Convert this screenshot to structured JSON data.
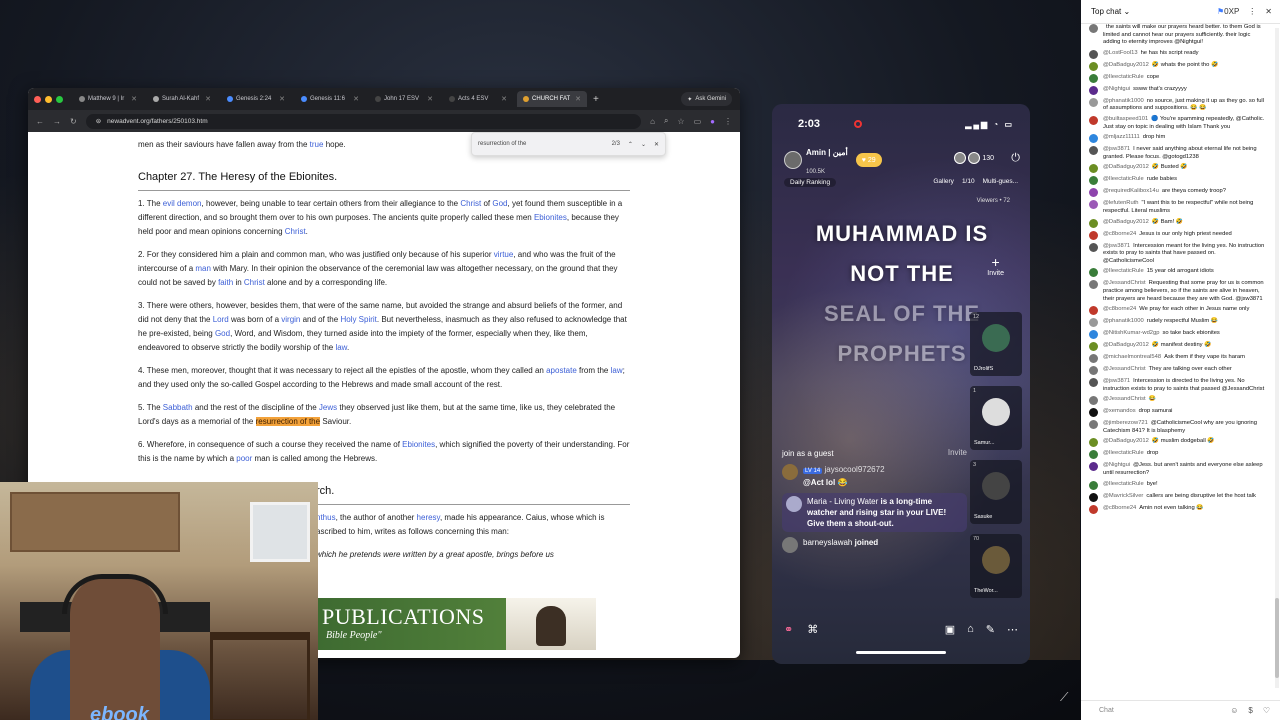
{
  "browser": {
    "tabs": [
      {
        "label": "Matthew 9 | Ir"
      },
      {
        "label": "Surah Al-Kahf"
      },
      {
        "label": "Genesis 2:24"
      },
      {
        "label": "Genesis 11:6"
      },
      {
        "label": "John 17 ESV"
      },
      {
        "label": "Acts 4 ESV"
      },
      {
        "label": "CHURCH FAT"
      }
    ],
    "new_tab": "+",
    "ask_gemini": "Ask Gemini",
    "url": "newadvent.org/fathers/250103.htm",
    "find": {
      "query": "resurrection of the",
      "count": "2/3"
    }
  },
  "page": {
    "top_line_pre": "men as their saviours have fallen away from the",
    "top_line_link": "true",
    "top_line_post": "hope.",
    "chapter_title": "Chapter 27. The Heresy of the Ebionites.",
    "p1": {
      "a": "1. The",
      "l1": "evil",
      "l2": "demon",
      "b": ", however, being unable to tear certain others from their allegiance to the",
      "l3": "Christ",
      "c": "of",
      "l4": "God",
      "d": ", yet found them susceptible in a different direction, and so brought them over to his own purposes. The ancients quite properly called these men",
      "l5": "Ebionites",
      "e": ", because they held poor and mean opinions concerning",
      "l6": "Christ",
      "f": "."
    },
    "p2": {
      "a": "2. For they considered him a plain and common man, who was justified only because of his superior",
      "l1": "virtue",
      "b": ", and who was the fruit of the intercourse of a",
      "l2": "man",
      "c": "with Mary. In their opinion the observance of the ceremonial law was altogether necessary, on the ground that they could not be saved by",
      "l3": "faith",
      "d": "in",
      "l4": "Christ",
      "e": "alone and by a corresponding life."
    },
    "p3": {
      "a": "3. There were others, however, besides them, that were of the same name, but avoided the strange and absurd beliefs of the former, and did not deny that the",
      "l1": "Lord",
      "b": "was born of a",
      "l2": "virgin",
      "c": "and of the",
      "l3": "Holy Spirit",
      "d": ". But nevertheless, inasmuch as they also refused to acknowledge that he pre-existed, being",
      "l4": "God",
      "e": ", Word, and Wisdom, they turned aside into the impiety of the former, especially when they, like them, endeavored to observe strictly the bodily worship of the",
      "l5": "law",
      "f": "."
    },
    "p4": {
      "a": "4. These men, moreover, thought that it was necessary to reject all the epistles of the apostle, whom they called an",
      "l1": "apostate",
      "b": "from the",
      "l2": "law",
      "c": "; and they used only the so-called Gospel according to the Hebrews and made small account of the rest."
    },
    "p5": {
      "a": "5. The",
      "l1": "Sabbath",
      "b": "and the rest of the discipline of the",
      "l2": "Jews",
      "c": "they observed just like them, but at the same time, like us, they celebrated the Lord's days as a memorial of the",
      "hl": "resurrection of the",
      "d": "Saviour."
    },
    "p6": {
      "a": "6. Wherefore, in consequence of such a course they received the name of",
      "l1": "Ebionites",
      "b": ", which signified the poverty of their understanding. For this is the name by which a",
      "l2": "poor",
      "c": "man is called among the Hebrews."
    },
    "ch2_title": "rch.",
    "p7": {
      "l1": "nthus",
      "a": ", the author of another",
      "l2": "heresy",
      "b": ", made his appearance. Caius, whose",
      "c": "which is ascribed to him, writes as follows concerning this man:"
    },
    "p8": {
      "a": "which he pretends were written by a great apostle, brings before us"
    },
    "p8_faded": "ere and / ere is"
  },
  "banner": {
    "title": "PUBLICATIONS",
    "sub": "Bible People\""
  },
  "webcam": {
    "shirt_text": "ebook"
  },
  "phone": {
    "time": "2:03",
    "host_name": "Amin | أمين",
    "host_likes": "100.5K",
    "heart_count": "29",
    "viewer_count": "130",
    "tabs": [
      "Daily Ranking",
      "Gallery",
      "1/10",
      "Multi-gues..."
    ],
    "viewers_label": "Viewers • 72",
    "banner_lines": [
      "MUHAMMAD IS",
      "NOT THE",
      "SEAL OF THE",
      "PROPHETS"
    ],
    "invite_plus": "+",
    "invite": "Invite",
    "guests": [
      {
        "num": "12",
        "name": "DJrolifS"
      },
      {
        "num": "1",
        "name": "Samur..."
      },
      {
        "num": "3",
        "name": "Sasuke"
      },
      {
        "num": "70",
        "name": "TheWor..."
      }
    ],
    "join_guest": "join as a guest",
    "invite2": "Invite",
    "feed": [
      {
        "user": "jaysocool972672",
        "text": "@Act lol 😂"
      },
      {
        "user": "Maria - Living Water",
        "text": "is a long-time watcher and rising star in your LIVE!"
      },
      {
        "user": "",
        "text": "Give them a shout-out."
      },
      {
        "user": "barneyslawah",
        "text": "joined"
      }
    ],
    "badge": "LV 14",
    "bottom_icons": [
      "⚭",
      "⌘",
      "▣",
      "⌂",
      "✎",
      "⋯"
    ]
  },
  "chat": {
    "title": "Top chat",
    "xp": "0XP",
    "input_placeholder": "Chat",
    "messages": [
      {
        "user": "",
        "text": "the saints will make our prayers heard better. to them God is limited and cannot hear our prayers sufficiently. their logic adding to eternity improves @Nightgui!",
        "color": "#777"
      },
      {
        "user": "@LostFool13",
        "text": "he has his script ready",
        "color": "#555"
      },
      {
        "user": "@DaBadguy2012",
        "text": "🤣 whats the point tho 🤣",
        "color": "#6b8e23"
      },
      {
        "user": "@IleectaticRule",
        "text": "cope",
        "color": "#3a7d3a"
      },
      {
        "user": "@Nightgui",
        "text": "ssww that's crazyyyy",
        "color": "#5b2b8c"
      },
      {
        "user": "@phanatik1000",
        "text": "no source, just making it up as they go. so full of assumptions and suppositions. 😂 😂",
        "color": "#999"
      },
      {
        "user": "@builtaspeed101",
        "text": "🔵 You're spamming repeatedly, @Catholic. Just stay on topic in dealing with Islam Thank you",
        "color": "#c0392b"
      },
      {
        "user": "@mljazz11111",
        "text": "drop him",
        "color": "#2e86de"
      },
      {
        "user": "@jsw3871",
        "text": "I never said anything about eternal life not being granted. Please focus. @gotogd1238",
        "color": "#555"
      },
      {
        "user": "@DaBadguy2012",
        "text": "🤣 Busted 🤣",
        "color": "#6b8e23"
      },
      {
        "user": "@IleectaticRule",
        "text": "rude babies",
        "color": "#3a7d3a"
      },
      {
        "user": "@requiredKalibox14u",
        "text": "are theya comedy troop?",
        "color": "#8e44ad"
      },
      {
        "user": "@lefutenRuth",
        "text": "\"I want this to be respectful\" while not being respectful. Literal muslims",
        "color": "#9b59b6"
      },
      {
        "user": "@DaBadguy2012",
        "text": "🤣 Bam! 🤣",
        "color": "#6b8e23"
      },
      {
        "user": "@c8borne24",
        "text": "Jesus is our only high priest needed",
        "color": "#c0392b"
      },
      {
        "user": "@jsw3871",
        "text": "Intercession meant for the living yes. No instruction exists to pray to saints that have passed on. @CatholicismeCool",
        "color": "#555"
      },
      {
        "user": "@IleectaticRule",
        "text": "15 year old arrogant idiots",
        "color": "#3a7d3a"
      },
      {
        "user": "@JessandChrist",
        "text": "Requesting that some pray for us is common practice among believers, so if the saints are alive in heaven, their prayers are heard because they are with God. @jsw3871",
        "color": "#777"
      },
      {
        "user": "@c8borne24",
        "text": "We pray for each other in Jesus name only",
        "color": "#c0392b"
      },
      {
        "user": "@phanatik1000",
        "text": "rudely respectful Muslim 😂",
        "color": "#999"
      },
      {
        "user": "@NitishKumar-wd2gp",
        "text": "so take back ebionites",
        "color": "#2e86de"
      },
      {
        "user": "@DaBadguy2012",
        "text": "🤣 manifest destiny 🤣",
        "color": "#6b8e23"
      },
      {
        "user": "@michaelmontreal548",
        "text": "Ask them if they vape its haram",
        "color": "#777"
      },
      {
        "user": "@JessandChrist",
        "text": "They are talking over each other",
        "color": "#777"
      },
      {
        "user": "@jsw3871",
        "text": "Intercession is directed to the living yes. No instruction exists to pray to saints that passed @JessandChrist",
        "color": "#555"
      },
      {
        "user": "@JessandChrist",
        "text": "😂",
        "color": "#777"
      },
      {
        "user": "@xemandos",
        "text": "drop samurai",
        "color": "#111"
      },
      {
        "user": "@jimberezow721",
        "text": "@CatholicismeCool why are you ignoring Catechism 841? It is blasphemy",
        "color": "#777"
      },
      {
        "user": "@DaBadguy2012",
        "text": "🤣 muslim dodgeball 🤣",
        "color": "#6b8e23"
      },
      {
        "user": "@IleectaticRule",
        "text": "drop",
        "color": "#3a7d3a"
      },
      {
        "user": "@Nightgui",
        "text": "@Jess. but aren't saints and everyone else asleep until resurrection?",
        "color": "#5b2b8c"
      },
      {
        "user": "@IleectaticRule",
        "text": "bye!",
        "color": "#3a7d3a"
      },
      {
        "user": "@MavrickSilver",
        "text": "callers are being disruptive let the host talk",
        "color": "#111"
      },
      {
        "user": "@c8borne24",
        "text": "Amin not even talking 😂",
        "color": "#c0392b"
      }
    ]
  }
}
